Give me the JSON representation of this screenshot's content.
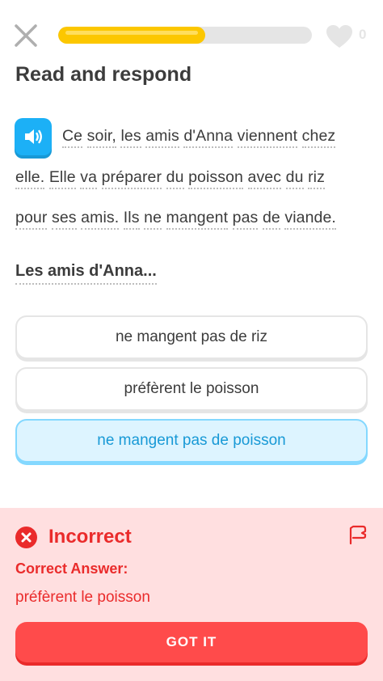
{
  "header": {
    "close_icon": "close-icon",
    "progress": 0.58,
    "progress_color": "#fcc700",
    "heart_icon": "heart-icon",
    "hearts_count": "0"
  },
  "title": "Read and respond",
  "passage": {
    "speaker_icon": "speaker-icon",
    "lines": [
      [
        "Ce",
        "soir,",
        "les",
        "amis",
        "d'Anna",
        "viennent",
        "chez"
      ],
      [
        "elle.",
        "Elle",
        "va",
        "préparer",
        "du",
        "poisson",
        "avec",
        "du",
        "riz"
      ],
      [
        "pour",
        "ses",
        "amis.",
        "Ils",
        "ne",
        "mangent",
        "pas",
        "de",
        "viande."
      ]
    ]
  },
  "question": "Les amis d'Anna...",
  "options": [
    {
      "label": "ne mangent pas de riz",
      "selected": false
    },
    {
      "label": "préfèrent le poisson",
      "selected": false
    },
    {
      "label": "ne mangent pas de poisson",
      "selected": true
    }
  ],
  "feedback": {
    "status_icon": "x-circle-icon",
    "title": "Incorrect",
    "flag_icon": "flag-icon",
    "correct_label": "Correct Answer:",
    "correct_answer": "préfèrent le poisson",
    "button_label": "GOT IT",
    "accent_color": "#ea2b2b",
    "background_color": "#ffdfe0"
  }
}
